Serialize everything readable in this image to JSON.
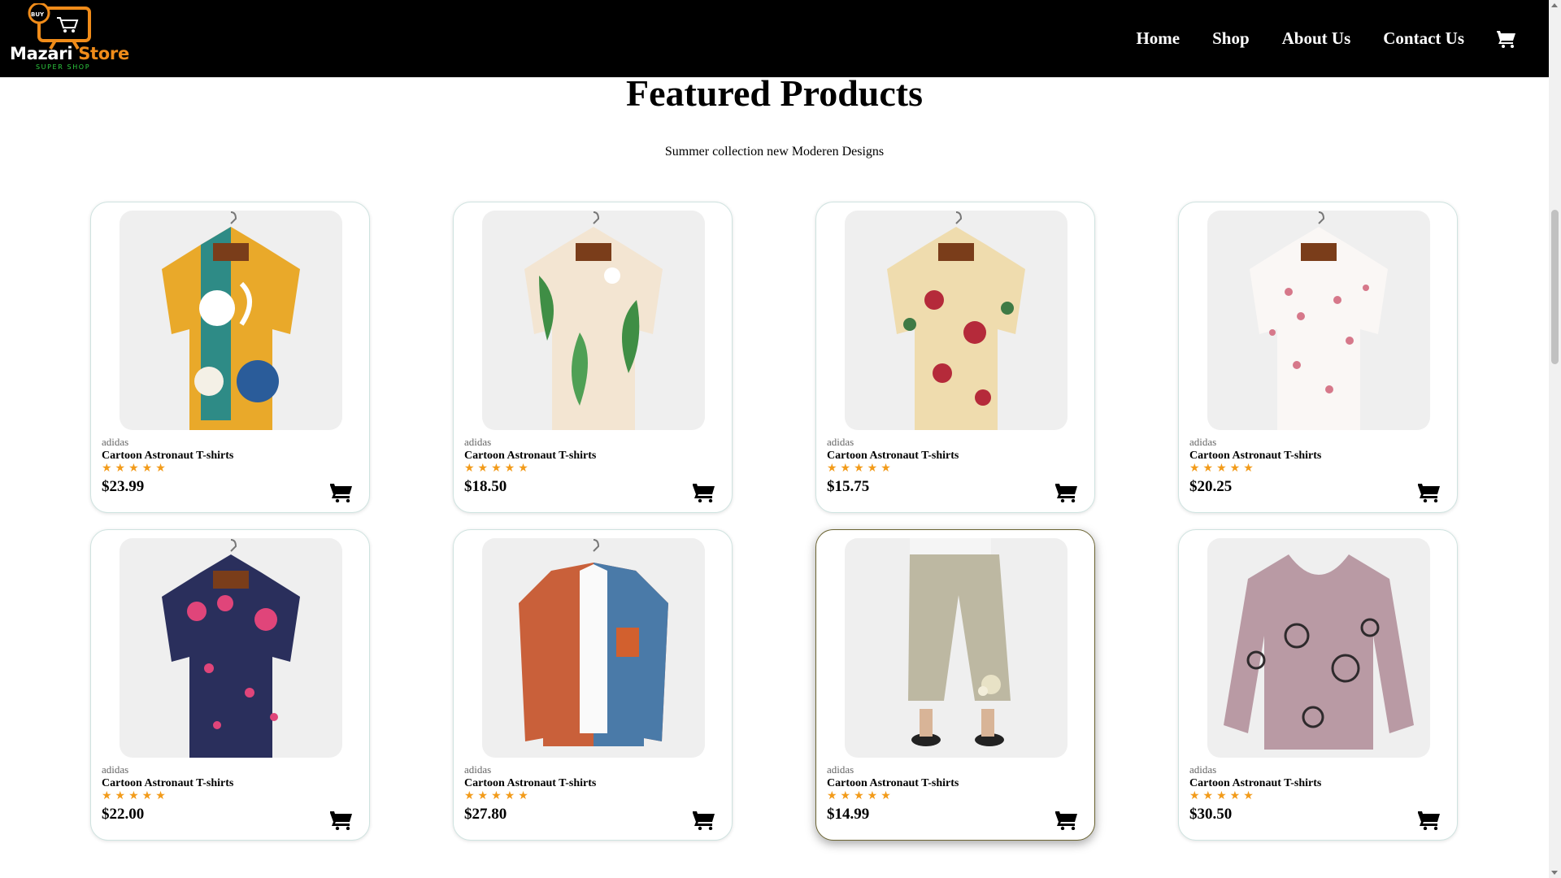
{
  "header": {
    "logo_badge": "BUY",
    "logo_name_1": "Mazari",
    "logo_name_2": "Store",
    "logo_tagline": "SUPER SHOP",
    "nav": [
      {
        "label": "Home"
      },
      {
        "label": "Shop"
      },
      {
        "label": "About Us"
      },
      {
        "label": "Contact Us"
      }
    ],
    "cart_icon": "cart-icon"
  },
  "section": {
    "title": "Featured Products",
    "subtitle": "Summer collection new Moderen Designs"
  },
  "products": [
    {
      "brand": "adidas",
      "name": "Cartoon Astronaut T-shirts",
      "rating": 5,
      "stars": "★★★★★",
      "price": "$23.99",
      "image": "colorful-abstract-shirt"
    },
    {
      "brand": "adidas",
      "name": "Cartoon Astronaut T-shirts",
      "rating": 5,
      "stars": "★★★★★",
      "price": "$18.50",
      "image": "tropical-leaf-shirt"
    },
    {
      "brand": "adidas",
      "name": "Cartoon Astronaut T-shirts",
      "rating": 5,
      "stars": "★★★★★",
      "price": "$15.75",
      "image": "cream-rose-shirt"
    },
    {
      "brand": "adidas",
      "name": "Cartoon Astronaut T-shirts",
      "rating": 5,
      "stars": "★★★★★",
      "price": "$20.25",
      "image": "white-blossom-shirt"
    },
    {
      "brand": "adidas",
      "name": "Cartoon Astronaut T-shirts",
      "rating": 5,
      "stars": "★★★★★",
      "price": "$22.00",
      "image": "navy-floral-shirt"
    },
    {
      "brand": "adidas",
      "name": "Cartoon Astronaut T-shirts",
      "rating": 5,
      "stars": "★★★★★",
      "price": "$27.80",
      "image": "corduroy-jacket"
    },
    {
      "brand": "adidas",
      "name": "Cartoon Astronaut T-shirts",
      "rating": 5,
      "stars": "★★★★★",
      "price": "$14.99",
      "image": "linen-pants"
    },
    {
      "brand": "adidas",
      "name": "Cartoon Astronaut T-shirts",
      "rating": 5,
      "stars": "★★★★★",
      "price": "$30.50",
      "image": "mauve-print-blouse"
    }
  ],
  "colors": {
    "header_bg": "#000000",
    "accent": "#f08c1a",
    "star": "#f29b1a"
  }
}
